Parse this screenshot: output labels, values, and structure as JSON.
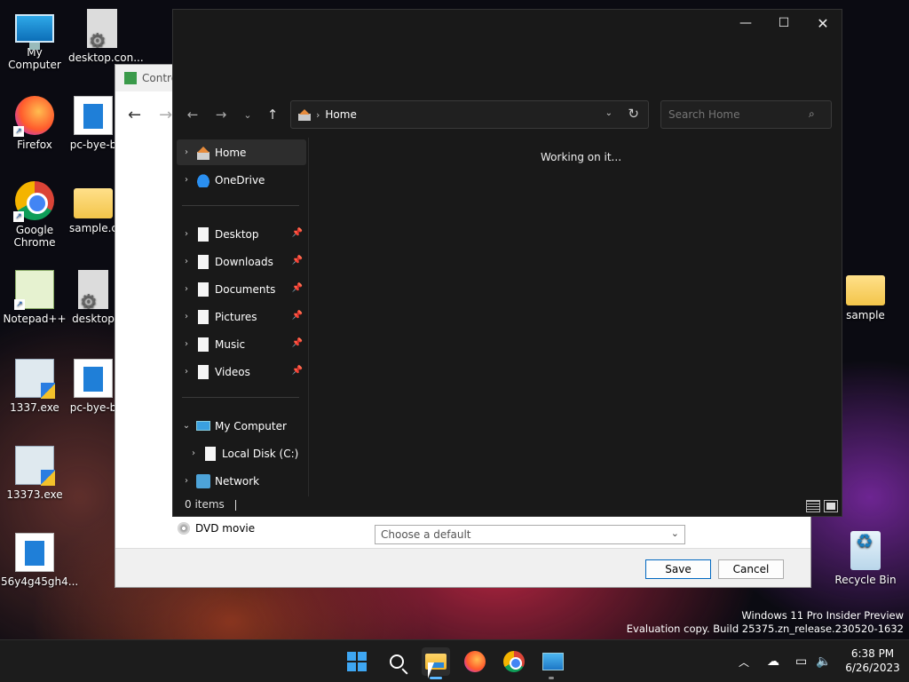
{
  "desktop": {
    "icons": [
      {
        "label": "My Computer"
      },
      {
        "label": "desktop.con..."
      },
      {
        "label": "Firefox"
      },
      {
        "label": "pc-bye-b"
      },
      {
        "label": "Google Chrome"
      },
      {
        "label": "sample.c"
      },
      {
        "label": "Notepad++"
      },
      {
        "label": "desktop"
      },
      {
        "label": "1337.exe"
      },
      {
        "label": "pc-bye-b"
      },
      {
        "label": "13373.exe"
      },
      {
        "label": "56y4g45gh4..."
      },
      {
        "label": "sample"
      },
      {
        "label": "Recycle Bin"
      }
    ]
  },
  "control_panel": {
    "title": "Contro",
    "dvd_label": "DVD movie",
    "dvd_select": "Choose a default",
    "save_label": "Save",
    "cancel_label": "Cancel"
  },
  "explorer": {
    "window_controls": {
      "minimize": "—",
      "maximize": "☐",
      "close": "✕"
    },
    "address": {
      "location": "Home"
    },
    "search": {
      "placeholder": "Search Home"
    },
    "sidebar": {
      "top": [
        {
          "label": "Home",
          "icon": "home-icon",
          "selected": true
        },
        {
          "label": "OneDrive",
          "icon": "cloud-icon"
        }
      ],
      "quick": [
        {
          "label": "Desktop",
          "icon": "page-icon",
          "pinned": true
        },
        {
          "label": "Downloads",
          "icon": "page-icon",
          "pinned": true
        },
        {
          "label": "Documents",
          "icon": "page-icon",
          "pinned": true
        },
        {
          "label": "Pictures",
          "icon": "page-icon",
          "pinned": true
        },
        {
          "label": "Music",
          "icon": "page-icon",
          "pinned": true
        },
        {
          "label": "Videos",
          "icon": "page-icon",
          "pinned": true
        }
      ],
      "devices": [
        {
          "label": "My Computer",
          "icon": "computer-icon",
          "expanded": true
        },
        {
          "label": "Local Disk (C:)",
          "icon": "page-icon"
        },
        {
          "label": "Network",
          "icon": "network-icon"
        }
      ]
    },
    "content_message": "Working on it...",
    "status": "0 items"
  },
  "watermark": {
    "line1": "Windows 11 Pro Insider Preview",
    "line2": "Evaluation copy. Build 25375.zn_release.230520-1632"
  },
  "taskbar": {
    "clock_time": "6:38 PM",
    "clock_date": "6/26/2023"
  },
  "colors": {
    "accent": "#0067c0",
    "explorer_bg": "#191919",
    "taskbar_bg": "#1c1c1c"
  }
}
